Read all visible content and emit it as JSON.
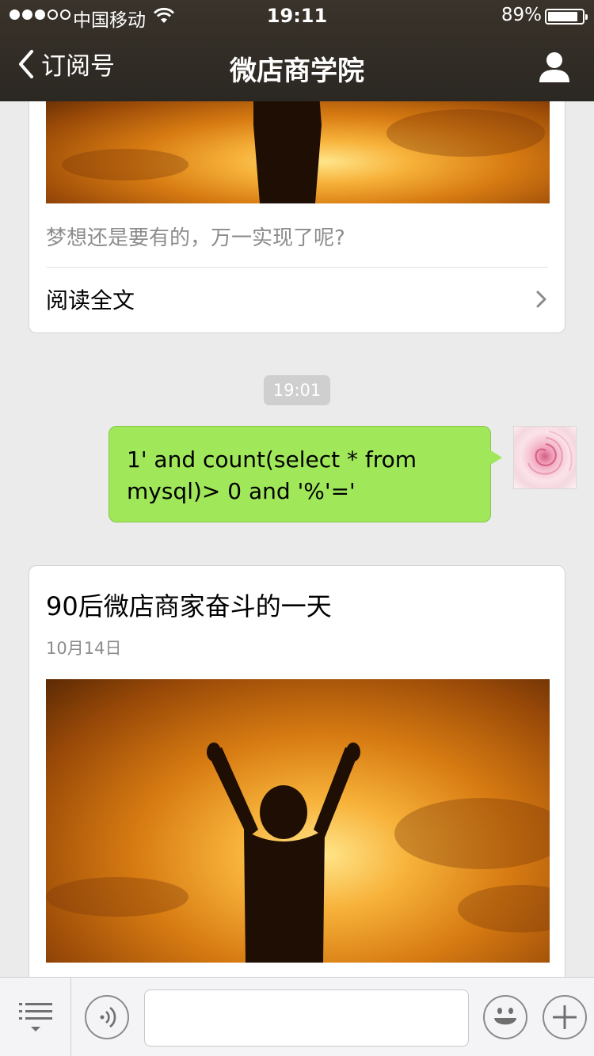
{
  "status_bar": {
    "carrier": "中国移动",
    "time": "19:11",
    "battery_text": "89%",
    "battery_level": 0.89,
    "signal_bars_filled": 3,
    "signal_bars_total": 5
  },
  "nav": {
    "back_label": "订阅号",
    "title": "微店商学院",
    "profile_icon": "person-icon"
  },
  "feed": {
    "top_card": {
      "description": "梦想还是要有的，万一实现了呢?",
      "read_more": "阅读全文"
    },
    "timestamp": "19:01",
    "sent_message": {
      "text": "1' and count(select * from mysql)> 0 and '%'='"
    },
    "article_card": {
      "title": "90后微店商家奋斗的一天",
      "date": "10月14日"
    }
  },
  "input_bar": {
    "menu_icon": "menu-list-icon",
    "voice_icon": "voice-icon",
    "emoji_icon": "smiley-icon",
    "plus_icon": "plus-icon",
    "message_value": ""
  },
  "colors": {
    "header_bg": "#2b2722",
    "bubble_green": "#a0e75a",
    "page_bg": "#ebebeb"
  }
}
